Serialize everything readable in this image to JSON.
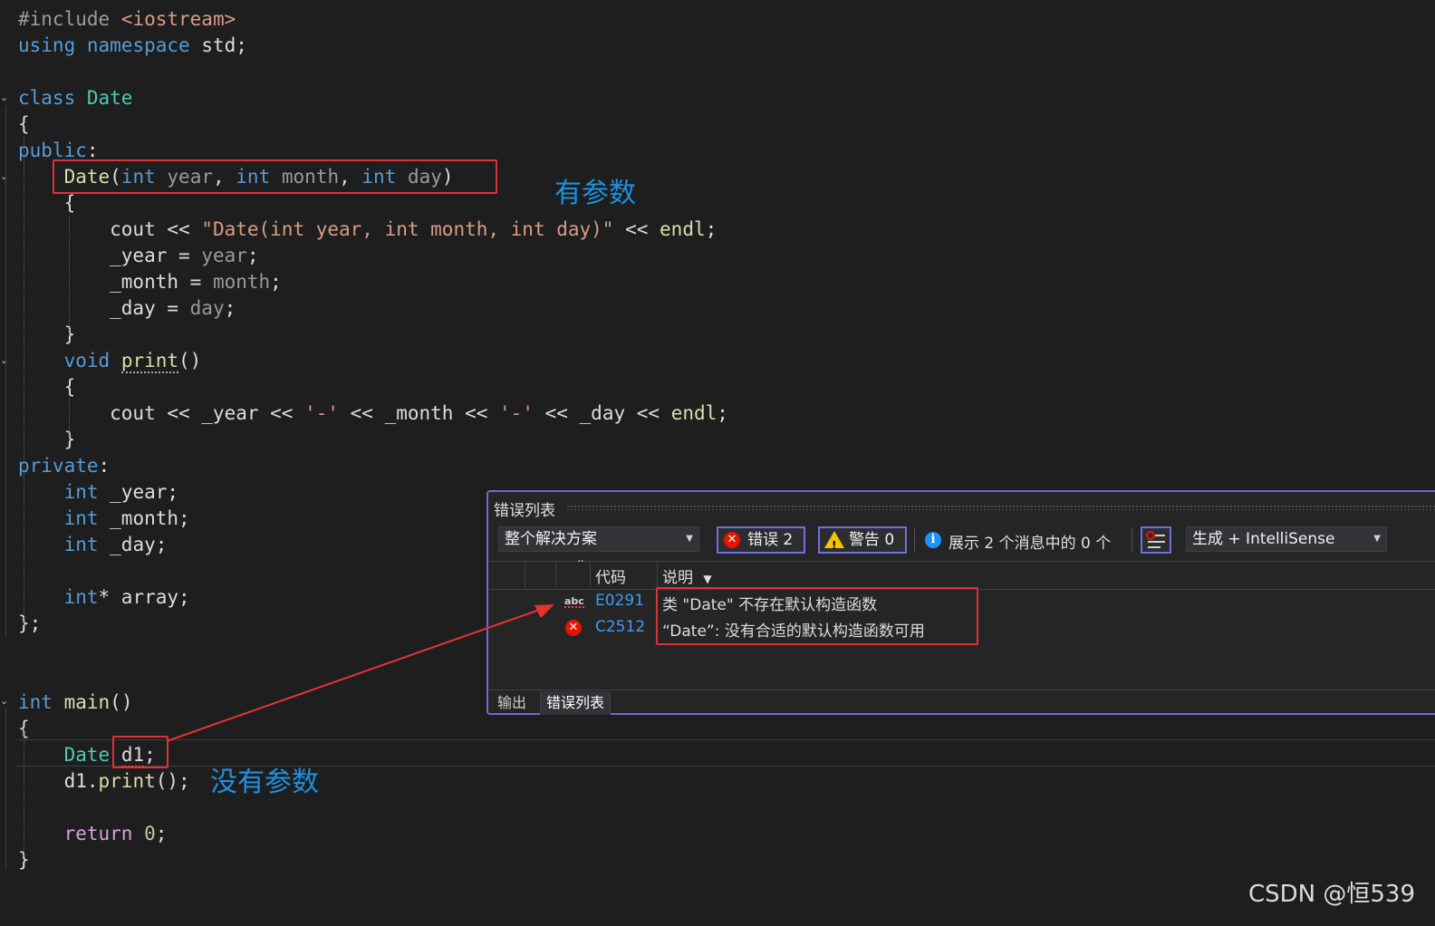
{
  "code_lines": [
    {
      "tokens": [
        {
          "t": "#include ",
          "c": "pp"
        },
        {
          "t": "<iostream>",
          "c": "in"
        }
      ]
    },
    {
      "tokens": [
        {
          "t": "using",
          "c": "kw"
        },
        {
          "t": " ",
          "c": "df"
        },
        {
          "t": "namespace",
          "c": "kw"
        },
        {
          "t": " std;",
          "c": "df"
        }
      ]
    },
    {
      "tokens": []
    },
    {
      "tokens": [
        {
          "t": "class",
          "c": "kw"
        },
        {
          "t": " ",
          "c": "df"
        },
        {
          "t": "Date",
          "c": "ty"
        }
      ]
    },
    {
      "tokens": [
        {
          "t": "{",
          "c": "df"
        }
      ]
    },
    {
      "tokens": [
        {
          "t": "public",
          "c": "kw"
        },
        {
          "t": ":",
          "c": "df"
        }
      ]
    },
    {
      "tokens": [
        {
          "t": "    ",
          "c": "df"
        },
        {
          "t": "Date",
          "c": "fn"
        },
        {
          "t": "(",
          "c": "df"
        },
        {
          "t": "int",
          "c": "kw"
        },
        {
          "t": " ",
          "c": "df"
        },
        {
          "t": "year",
          "c": "pr"
        },
        {
          "t": ", ",
          "c": "df"
        },
        {
          "t": "int",
          "c": "kw"
        },
        {
          "t": " ",
          "c": "df"
        },
        {
          "t": "month",
          "c": "pr"
        },
        {
          "t": ", ",
          "c": "df"
        },
        {
          "t": "int",
          "c": "kw"
        },
        {
          "t": " ",
          "c": "df"
        },
        {
          "t": "day",
          "c": "pr"
        },
        {
          "t": ")",
          "c": "df"
        }
      ]
    },
    {
      "tokens": [
        {
          "t": "    {",
          "c": "df"
        }
      ]
    },
    {
      "tokens": [
        {
          "t": "        cout << ",
          "c": "df"
        },
        {
          "t": "\"Date(int year, int month, int day)\"",
          "c": "st"
        },
        {
          "t": " << ",
          "c": "df"
        },
        {
          "t": "endl",
          "c": "fn"
        },
        {
          "t": ";",
          "c": "df"
        }
      ]
    },
    {
      "tokens": [
        {
          "t": "        _year = ",
          "c": "df"
        },
        {
          "t": "year",
          "c": "pr"
        },
        {
          "t": ";",
          "c": "df"
        }
      ]
    },
    {
      "tokens": [
        {
          "t": "        _month = ",
          "c": "df"
        },
        {
          "t": "month",
          "c": "pr"
        },
        {
          "t": ";",
          "c": "df"
        }
      ]
    },
    {
      "tokens": [
        {
          "t": "        _day = ",
          "c": "df"
        },
        {
          "t": "day",
          "c": "pr"
        },
        {
          "t": ";",
          "c": "df"
        }
      ]
    },
    {
      "tokens": [
        {
          "t": "    }",
          "c": "df"
        }
      ]
    },
    {
      "tokens": [
        {
          "t": "    ",
          "c": "df"
        },
        {
          "t": "void",
          "c": "kw"
        },
        {
          "t": " ",
          "c": "df"
        },
        {
          "t": "print",
          "c": "fn",
          "sq": true
        },
        {
          "t": "()",
          "c": "df"
        }
      ]
    },
    {
      "tokens": [
        {
          "t": "    {",
          "c": "df"
        }
      ]
    },
    {
      "tokens": [
        {
          "t": "        cout << _year << ",
          "c": "df"
        },
        {
          "t": "'-'",
          "c": "st"
        },
        {
          "t": " << _month << ",
          "c": "df"
        },
        {
          "t": "'-'",
          "c": "st"
        },
        {
          "t": " << _day << ",
          "c": "df"
        },
        {
          "t": "endl",
          "c": "fn"
        },
        {
          "t": ";",
          "c": "df"
        }
      ]
    },
    {
      "tokens": [
        {
          "t": "    }",
          "c": "df"
        }
      ]
    },
    {
      "tokens": [
        {
          "t": "private",
          "c": "kw"
        },
        {
          "t": ":",
          "c": "df"
        }
      ]
    },
    {
      "tokens": [
        {
          "t": "    ",
          "c": "df"
        },
        {
          "t": "int",
          "c": "kw"
        },
        {
          "t": " _year;",
          "c": "df"
        }
      ]
    },
    {
      "tokens": [
        {
          "t": "    ",
          "c": "df"
        },
        {
          "t": "int",
          "c": "kw"
        },
        {
          "t": " _month;",
          "c": "df"
        }
      ]
    },
    {
      "tokens": [
        {
          "t": "    ",
          "c": "df"
        },
        {
          "t": "int",
          "c": "kw"
        },
        {
          "t": " _day;",
          "c": "df"
        }
      ]
    },
    {
      "tokens": []
    },
    {
      "tokens": [
        {
          "t": "    ",
          "c": "df"
        },
        {
          "t": "int",
          "c": "kw"
        },
        {
          "t": "* array;",
          "c": "df"
        }
      ]
    },
    {
      "tokens": [
        {
          "t": "};",
          "c": "df"
        }
      ]
    },
    {
      "tokens": []
    },
    {
      "tokens": []
    },
    {
      "tokens": [
        {
          "t": "int",
          "c": "kw"
        },
        {
          "t": " ",
          "c": "df"
        },
        {
          "t": "main",
          "c": "fn"
        },
        {
          "t": "()",
          "c": "df"
        }
      ]
    },
    {
      "tokens": [
        {
          "t": "{",
          "c": "df"
        }
      ]
    },
    {
      "tokens": [
        {
          "t": "    ",
          "c": "df"
        },
        {
          "t": "Date",
          "c": "ty"
        },
        {
          "t": " ",
          "c": "df"
        },
        {
          "t": "d1",
          "c": "df",
          "sqr": true
        },
        {
          "t": ";",
          "c": "df"
        }
      ]
    },
    {
      "tokens": [
        {
          "t": "    d1.",
          "c": "df"
        },
        {
          "t": "print",
          "c": "fn"
        },
        {
          "t": "();",
          "c": "df"
        }
      ]
    },
    {
      "tokens": []
    },
    {
      "tokens": [
        {
          "t": "    ",
          "c": "df"
        },
        {
          "t": "return",
          "c": "ctl"
        },
        {
          "t": " ",
          "c": "df"
        },
        {
          "t": "0",
          "c": "nu"
        },
        {
          "t": ";",
          "c": "df"
        }
      ]
    },
    {
      "tokens": [
        {
          "t": "}",
          "c": "df"
        }
      ]
    }
  ],
  "annotations": {
    "has_params": "有参数",
    "no_params": "没有参数"
  },
  "error_list": {
    "title": "错误列表",
    "scope_dropdown": "整个解决方案",
    "errors_button": "错误 2",
    "warnings_button": "警告 0",
    "messages_text": "展示 2 个消息中的 0 个",
    "source_dropdown": "生成 + IntelliSense",
    "columns": {
      "code": "代码",
      "description": "说明"
    },
    "rows": [
      {
        "code": "E0291",
        "description": "类 \"Date\" 不存在默认构造函数"
      },
      {
        "code": "C2512",
        "description": "“Date”: 没有合适的默认构造函数可用"
      }
    ],
    "tabs": [
      "输出",
      "错误列表"
    ],
    "active_tab": "错误列表"
  },
  "watermark": "CSDN @恒539",
  "colors": {
    "keyword": "#569cd6",
    "type": "#4ec9b0",
    "function": "#dcdcaa",
    "string": "#d69d85",
    "param": "#9a9a9a",
    "annotation": "#1e90e0",
    "highlight_box": "#e0303a",
    "panel_border": "#7d5fd6"
  }
}
